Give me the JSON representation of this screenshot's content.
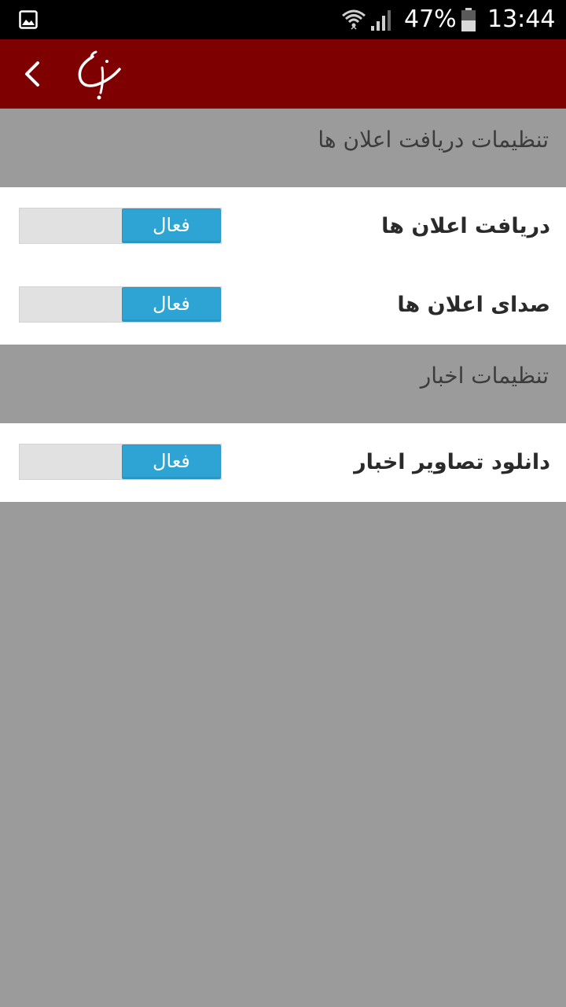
{
  "status_bar": {
    "battery_percent": "47%",
    "time": "13:44",
    "icons": [
      "gallery-icon",
      "wifi-icon",
      "signal-icon",
      "battery-icon"
    ]
  },
  "app_bar": {
    "background_color": "#7f0000",
    "back_icon": "chevron-left-icon",
    "logo_icon": "calligraphy-logo-icon"
  },
  "sections": [
    {
      "title": "تنظیمات دریافت اعلان ها",
      "settings": [
        {
          "label": "دریافت اعلان ها",
          "toggle_label": "فعال",
          "enabled": true
        },
        {
          "label": "صدای اعلان ها",
          "toggle_label": "فعال",
          "enabled": true
        }
      ]
    },
    {
      "title": "تنظیمات اخبار",
      "settings": [
        {
          "label": "دانلود تصاویر اخبار",
          "toggle_label": "فعال",
          "enabled": true
        }
      ]
    }
  ],
  "colors": {
    "toggle_on": "#2ea4d4",
    "toggle_track": "#e1e1e1",
    "page_background": "#9b9b9b"
  }
}
